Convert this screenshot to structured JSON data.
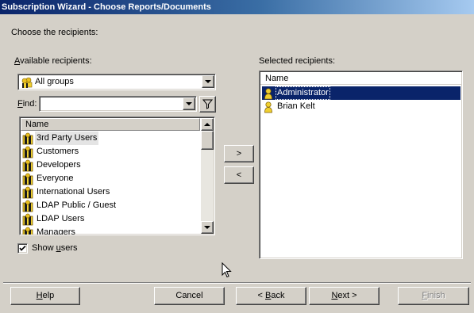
{
  "window": {
    "title": "Subscription Wizard - Choose Reports/Documents"
  },
  "instructions": "Choose the recipients:",
  "available": {
    "label": "Available recipients:",
    "group_select": {
      "value": "All groups",
      "icon": "group-icon"
    },
    "find_label": "Find:",
    "find_value": "",
    "filter_icon": "filter-funnel-icon",
    "column_header": "Name",
    "items": [
      {
        "label": "3rd Party Users",
        "icon": "group-icon"
      },
      {
        "label": "Customers",
        "icon": "group-icon"
      },
      {
        "label": "Developers",
        "icon": "group-icon"
      },
      {
        "label": "Everyone",
        "icon": "group-icon"
      },
      {
        "label": "International Users",
        "icon": "group-icon"
      },
      {
        "label": "LDAP Public / Guest",
        "icon": "group-icon"
      },
      {
        "label": "LDAP Users",
        "icon": "group-icon"
      },
      {
        "label": "Managers",
        "icon": "group-icon"
      }
    ],
    "show_users": {
      "label": "Show users",
      "checked": true
    }
  },
  "move_buttons": {
    "add": ">",
    "remove": "<"
  },
  "selected": {
    "label": "Selected recipients:",
    "column_header": "Name",
    "items": [
      {
        "label": "Administrator",
        "icon": "user-icon",
        "selected": true
      },
      {
        "label": "Brian Kelt",
        "icon": "user-icon",
        "selected": false
      }
    ]
  },
  "buttons": {
    "help": "Help",
    "cancel": "Cancel",
    "back": "< Back",
    "next": "Next >",
    "finish": "Finish"
  },
  "colors": {
    "title_gradient_start": "#0a246a",
    "title_gradient_end": "#a6caf0",
    "selection": "#0a246a",
    "face": "#d4d0c8"
  }
}
